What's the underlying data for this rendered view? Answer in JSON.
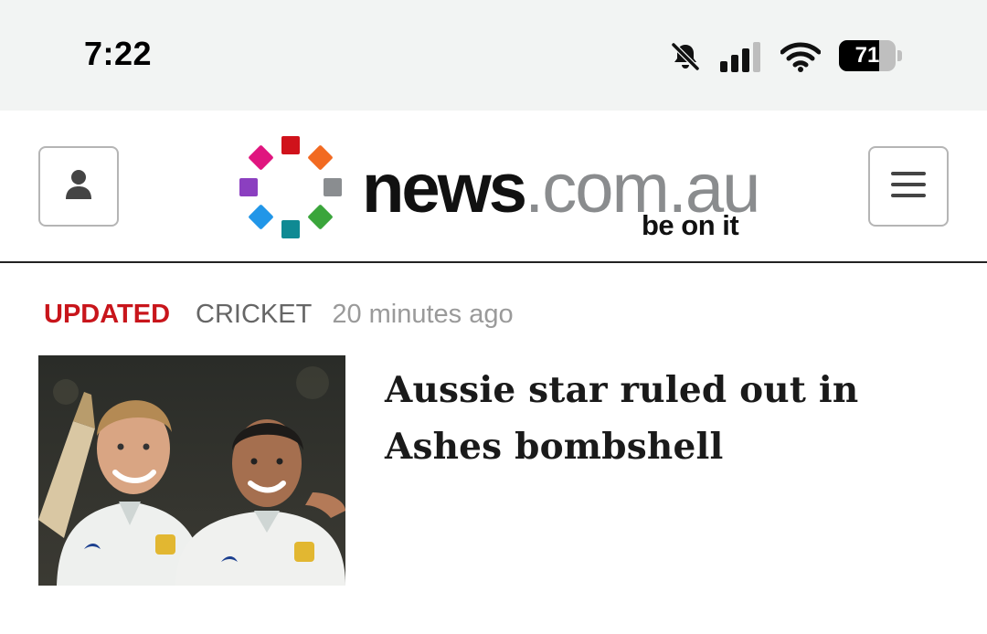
{
  "status_bar": {
    "time": "7:22",
    "battery_level": "71",
    "battery_fraction": 0.71,
    "silent_icon": "bell-slash-icon",
    "signal_icon": "cellular-signal-icon",
    "wifi_icon": "wifi-icon"
  },
  "header": {
    "account_icon": "user-icon",
    "menu_icon": "hamburger-menu-icon",
    "logo": {
      "brand": "news",
      "domain": ".com.au",
      "tagline": "be on it",
      "dot_colors": [
        "#d0121b",
        "#f26a21",
        "#8a8d90",
        "#3aa53b",
        "#0f8a93",
        "#2196e8",
        "#8b3fc0",
        "#e0157f"
      ]
    }
  },
  "article": {
    "status_tag": "UPDATED",
    "section": "CRICKET",
    "timestamp": "20 minutes ago",
    "headline": "Aussie star ruled out in Ashes bombshell",
    "image_alt": "Two smiling Australian cricketers in white Test shirts, one holding a bat"
  },
  "colors": {
    "updated_red": "#c8151b",
    "statusbar_bg": "#f2f4f3",
    "divider": "#222222"
  }
}
